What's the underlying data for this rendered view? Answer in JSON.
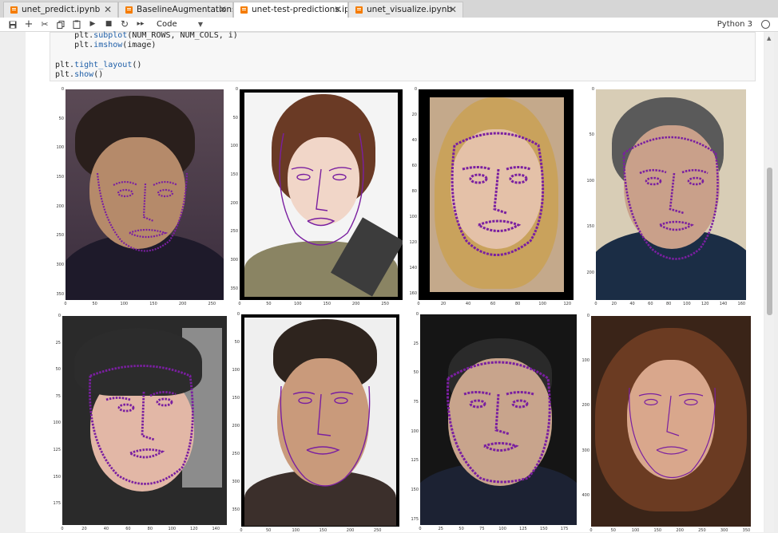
{
  "tabs": [
    {
      "label": "unet_predict.ipynb"
    },
    {
      "label": "BaselineAugmentations.ipynb"
    },
    {
      "label": "unet-test-predictions.ipynb"
    },
    {
      "label": "unet_visualize.ipynb"
    }
  ],
  "toolbar": {
    "cell_type": "Code",
    "kernel": "Python 3",
    "icons": [
      "save-icon",
      "add-icon",
      "cut-icon",
      "copy-icon",
      "paste-icon",
      "run-icon",
      "stop-icon",
      "restart-icon",
      "fast-forward-icon"
    ]
  },
  "code": {
    "line1_pre": "    plt.",
    "line1_fn": "subplot",
    "line1_post": "(NUM_ROWS, NUM_COLS, i)",
    "line2_pre": "    plt.",
    "line2_fn": "imshow",
    "line2_post": "(image)",
    "line3_pre": "plt.",
    "line3_fn": "tight_layout",
    "line3_post": "()",
    "line4_pre": "plt.",
    "line4_fn": "show",
    "line4_post": "()"
  },
  "colors": {
    "landmark": "#7a1fa0",
    "orange_notebook": "#f57c00"
  },
  "plots": [
    {
      "yticks": [
        "0",
        "50",
        "100",
        "150",
        "200",
        "250",
        "300",
        "350"
      ],
      "xticks": [
        "0",
        "50",
        "100",
        "150",
        "200",
        "250"
      ],
      "ymax": 360,
      "xmax": 270
    },
    {
      "yticks": [
        "0",
        "50",
        "100",
        "150",
        "200",
        "250",
        "300",
        "350"
      ],
      "xticks": [
        "0",
        "50",
        "100",
        "150",
        "200",
        "250"
      ],
      "ymax": 370,
      "xmax": 280
    },
    {
      "yticks": [
        "0",
        "20",
        "40",
        "60",
        "80",
        "100",
        "120",
        "140",
        "160"
      ],
      "xticks": [
        "0",
        "20",
        "40",
        "60",
        "80",
        "100",
        "120"
      ],
      "ymax": 165,
      "xmax": 125
    },
    {
      "yticks": [
        "0",
        "50",
        "100",
        "150",
        "200"
      ],
      "xticks": [
        "0",
        "20",
        "40",
        "60",
        "80",
        "100",
        "120",
        "140",
        "160"
      ],
      "ymax": 230,
      "xmax": 165
    },
    {
      "yticks": [
        "0",
        "25",
        "50",
        "75",
        "100",
        "125",
        "150",
        "175"
      ],
      "xticks": [
        "0",
        "20",
        "40",
        "60",
        "80",
        "100",
        "120",
        "140"
      ],
      "ymax": 195,
      "xmax": 150
    },
    {
      "yticks": [
        "0",
        "50",
        "100",
        "150",
        "200",
        "250",
        "300",
        "350"
      ],
      "xticks": [
        "0",
        "50",
        "100",
        "150",
        "200",
        "250"
      ],
      "ymax": 380,
      "xmax": 290
    },
    {
      "yticks": [
        "0",
        "25",
        "50",
        "75",
        "100",
        "125",
        "150",
        "175"
      ],
      "xticks": [
        "0",
        "25",
        "50",
        "75",
        "100",
        "125",
        "150",
        "175"
      ],
      "ymax": 180,
      "xmax": 190
    },
    {
      "yticks": [
        "0",
        "100",
        "200",
        "300",
        "400"
      ],
      "xticks": [
        "0",
        "50",
        "100",
        "150",
        "200",
        "250",
        "300",
        "350"
      ],
      "ymax": 470,
      "xmax": 360
    }
  ]
}
